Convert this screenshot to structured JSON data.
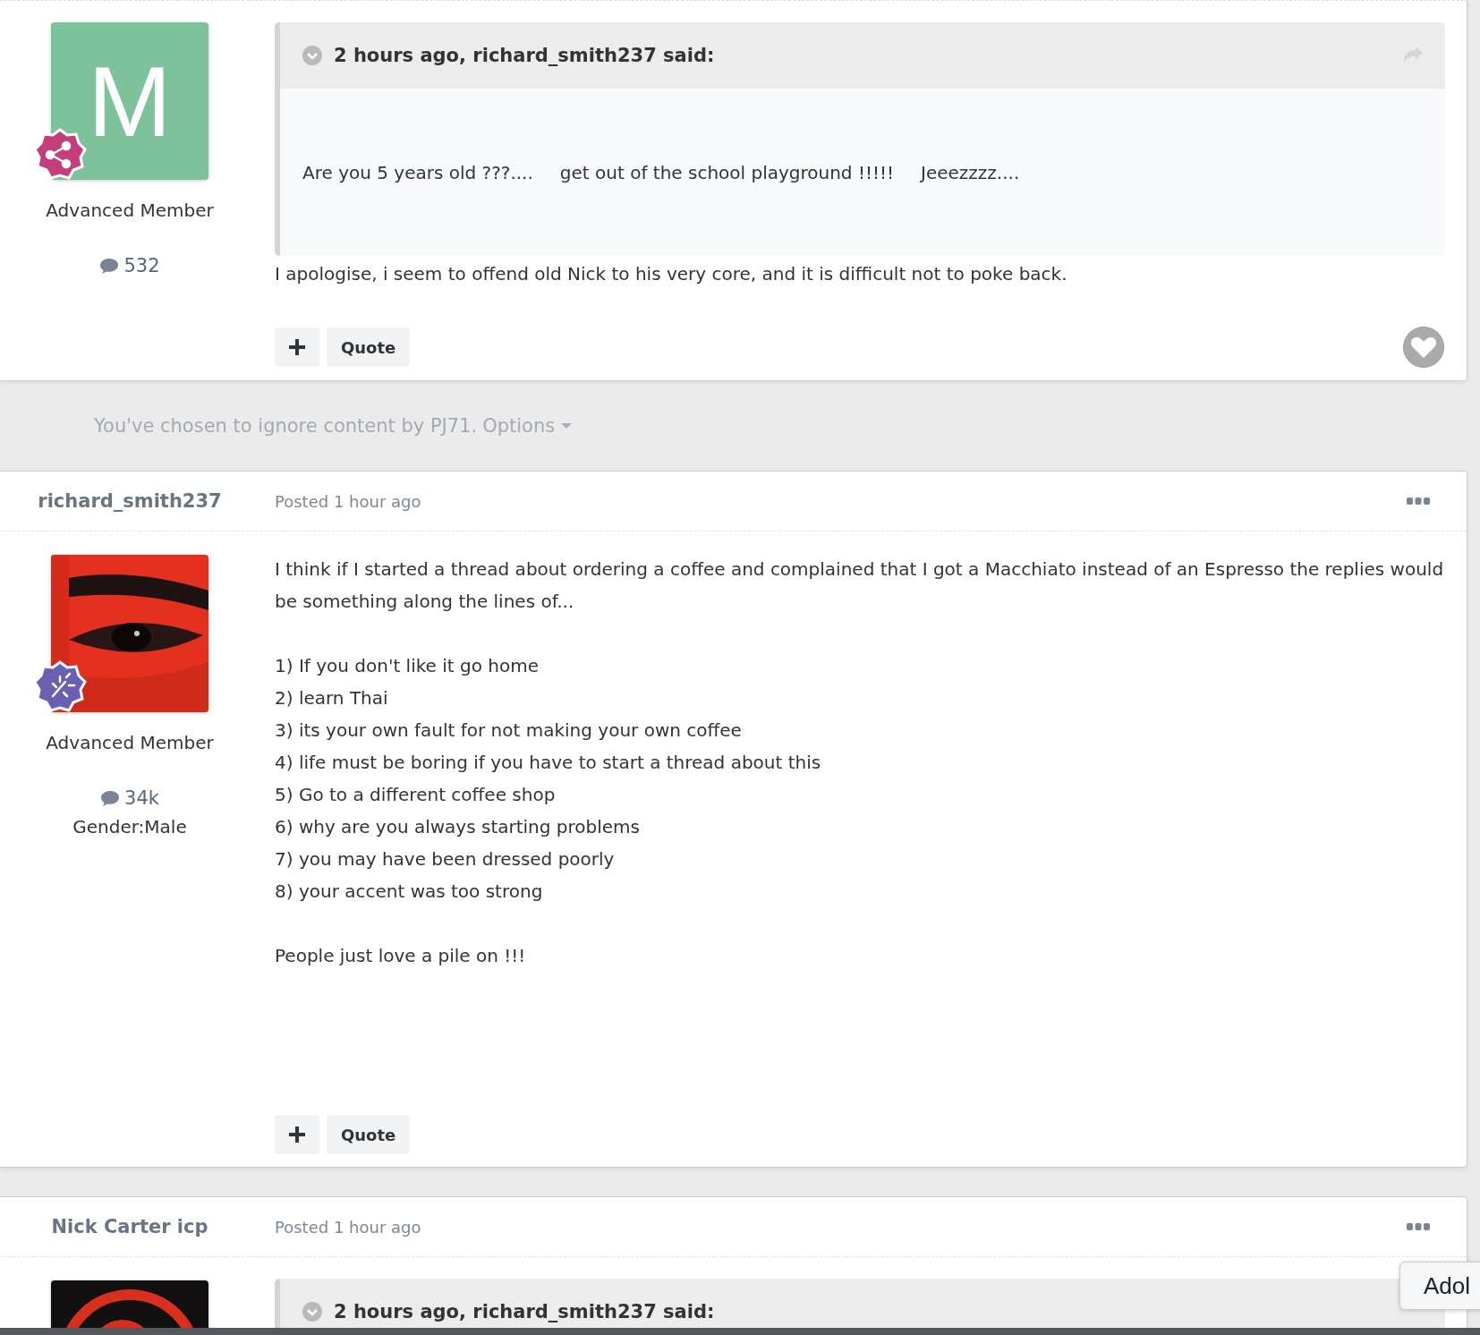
{
  "feed": [
    {
      "kind": "post",
      "avatar": {
        "kind": "letter",
        "letter": "M",
        "color": "#7dc29a"
      },
      "badge": {
        "kind": "share",
        "color": "#c43d7c"
      },
      "rank": "Advanced Member",
      "post_count": "532",
      "quote": {
        "citation": "2 hours ago, richard_smith237 said:",
        "segments": [
          "Are you 5 years old ???....",
          "get out of the school playground !!!!!",
          "Jeeezzzz...."
        ]
      },
      "body": [
        {
          "kind": "paragraph",
          "text": "I apologise, i seem to offend old Nick to his very core, and it is difficult not to poke back."
        }
      ],
      "actions": [
        "Quote"
      ],
      "like": true
    },
    {
      "kind": "ignored",
      "text": "You've chosen to ignore content by PJ71.",
      "link": "Options"
    },
    {
      "kind": "post",
      "author": "richard_smith237",
      "posted": "Posted 1 hour ago",
      "avatar": {
        "kind": "picture"
      },
      "badge": {
        "kind": "burst",
        "color": "#6a5fb0"
      },
      "rank": "Advanced Member",
      "post_count": "34k",
      "gender": {
        "label": "Gender:",
        "value": "Male"
      },
      "body": [
        {
          "kind": "paragraph",
          "text": "I think if I started a thread about ordering a coffee and complained that I got a Macchiato instead of an Espresso the replies would be something along the lines of..."
        },
        {
          "kind": "lines",
          "lines": [
            "1) If you don't like it go home",
            "2) learn Thai",
            "3) its your own fault for not making your own coffee",
            "4) life must be boring if you have to start a thread about this",
            "5) Go to a different coffee shop",
            "6) why are you always starting problems",
            "7) you may have been dressed poorly",
            "8) your accent was too strong"
          ]
        },
        {
          "kind": "paragraph",
          "text": "People just love a pile on !!!"
        }
      ],
      "actions": [
        "Quote"
      ],
      "like": false
    },
    {
      "kind": "post",
      "author": "Nick Carter icp",
      "posted": "Posted 1 hour ago",
      "avatar": {
        "kind": "picture"
      },
      "quote": {
        "citation": "2 hours ago, richard_smith237 said:"
      }
    }
  ],
  "side_popup": "Adol"
}
